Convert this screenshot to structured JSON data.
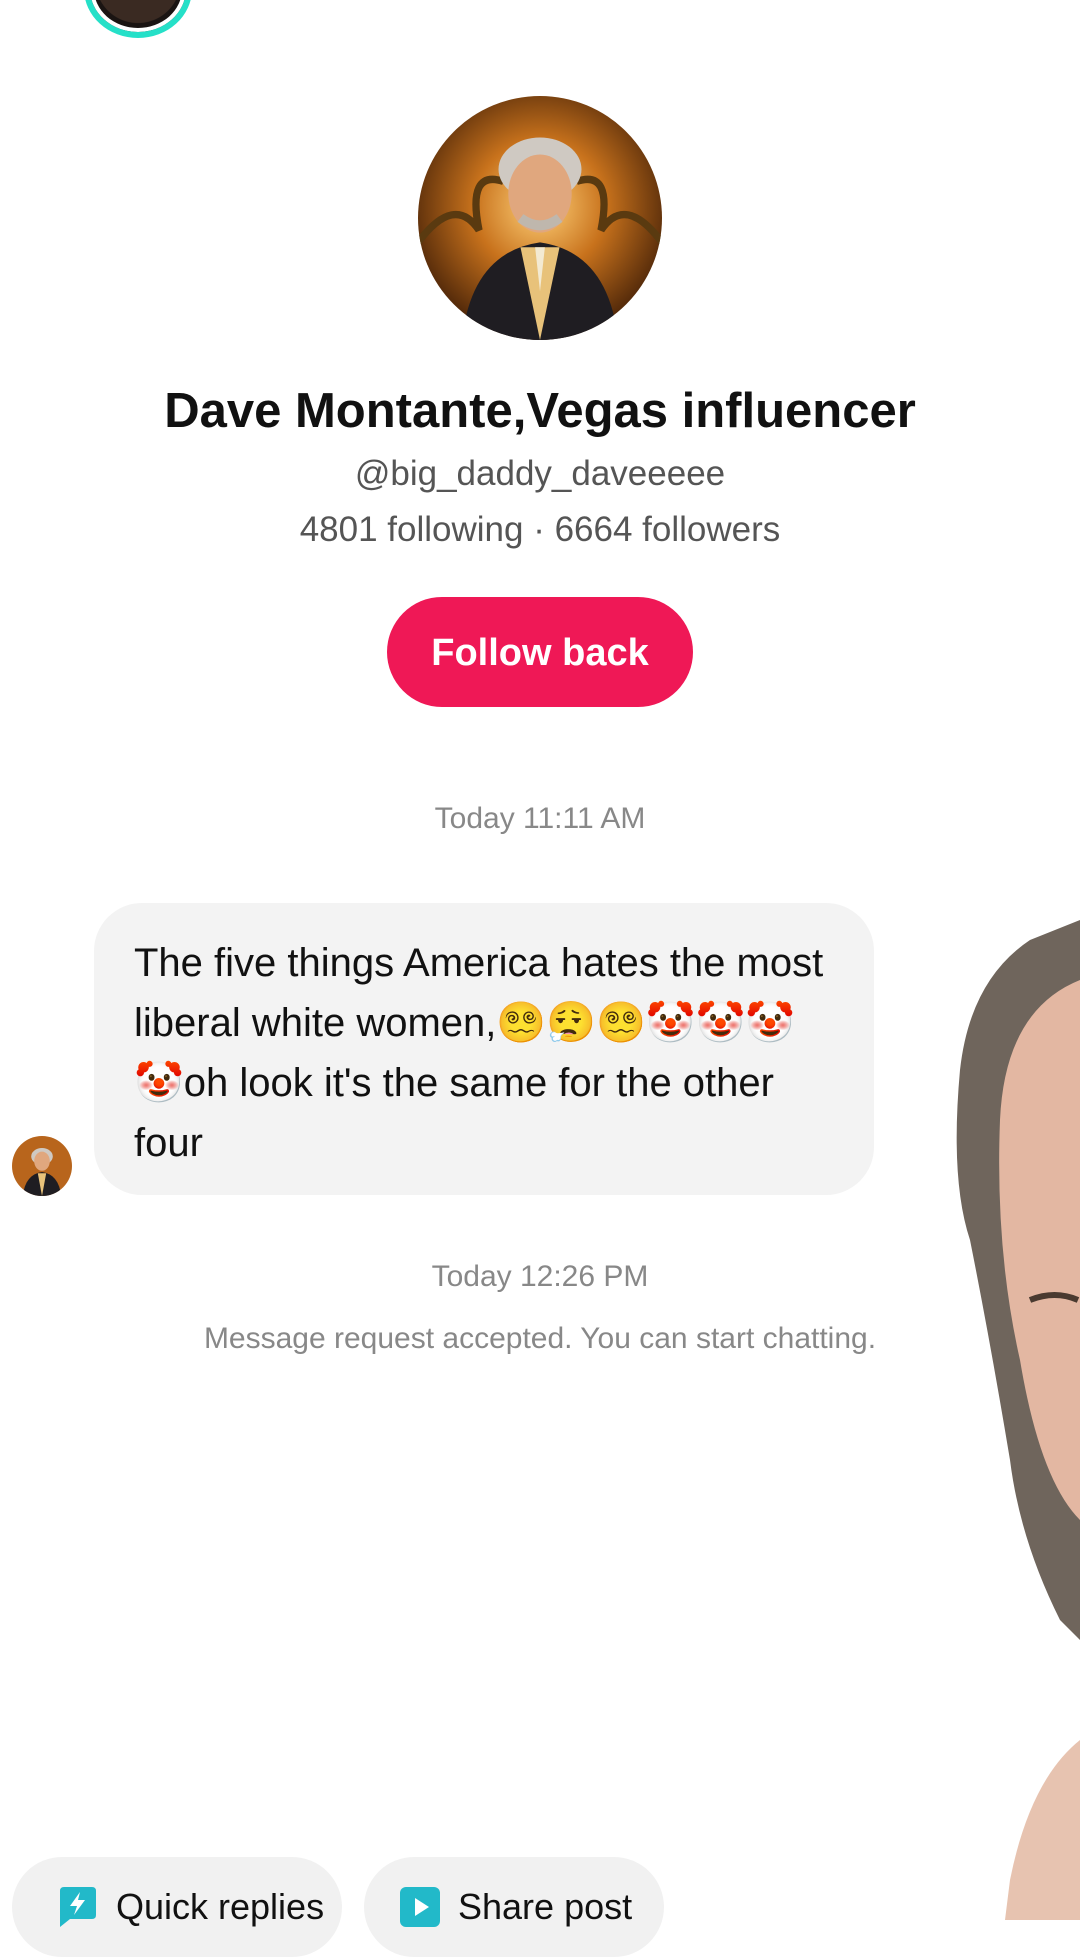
{
  "profile": {
    "display_name": "Dave Montante,Vegas influencer",
    "handle": "@big_daddy_daveeeee",
    "stats": "4801 following · 6664 followers",
    "follow_button": "Follow back"
  },
  "chat": {
    "messages": [
      {
        "timestamp": "Today 11:11 AM",
        "text": "The five things America hates the most liberal white women,😵‍💫😮‍💨😵‍💫🤡🤡🤡🤡oh look it's the same for the other four"
      }
    ],
    "second_timestamp": "Today 12:26 PM",
    "system_note": "Message request accepted. You can start chatting."
  },
  "actions": {
    "quick_replies": "Quick replies",
    "share_post": "Share post"
  },
  "icons": {
    "quick_replies": "lightning-bubble-icon",
    "share_post": "play-square-icon"
  },
  "colors": {
    "follow_button": "#ef1856",
    "icon_teal": "#22b9c9",
    "story_ring": "#25e0c8"
  }
}
